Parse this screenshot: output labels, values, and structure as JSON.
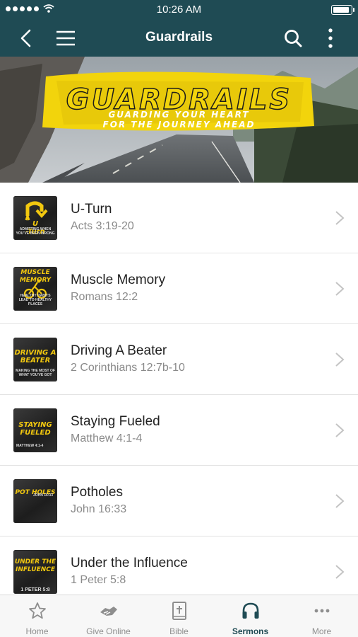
{
  "status_bar": {
    "time": "10:26 AM"
  },
  "nav": {
    "title": "Guardrails"
  },
  "banner": {
    "title": "GUARDRAILS",
    "subtitle_line1": "GUARDING YOUR HEART",
    "subtitle_line2": "FOR THE JOURNEY AHEAD"
  },
  "sermons": [
    {
      "title": "U-Turn",
      "reference": "Acts 3:19-20",
      "thumb_text": "U\n-Turn",
      "thumb_small": "ADMITTING WHEN YOU'VE BEEN WRONG"
    },
    {
      "title": "Muscle Memory",
      "reference": "Romans 12:2",
      "thumb_text": "MUSCLE MEMORY",
      "thumb_small": "HEALTHY HABITS LEAD TO HEALTHY PLACES"
    },
    {
      "title": "Driving A Beater",
      "reference": "2 Corinthians 12:7b-10",
      "thumb_text": "DRIVING A BEATER",
      "thumb_small": "MAKING THE MOST OF WHAT YOU'VE GOT"
    },
    {
      "title": "Staying Fueled",
      "reference": "Matthew 4:1-4",
      "thumb_text": "STAYING FUELED",
      "thumb_small": "MATTHEW 4:1-4"
    },
    {
      "title": "Potholes",
      "reference": "John 16:33",
      "thumb_text": "POT HOLES",
      "thumb_small": "JOHN 16:33"
    },
    {
      "title": "Under the Influence",
      "reference": "1 Peter 5:8",
      "thumb_text": "UNDER THE INFLUENCE",
      "thumb_small": "1 PETER 5:8"
    }
  ],
  "tabs": [
    {
      "label": "Home",
      "icon": "star-icon"
    },
    {
      "label": "Give Online",
      "icon": "handshake-icon"
    },
    {
      "label": "Bible",
      "icon": "bible-icon"
    },
    {
      "label": "Sermons",
      "icon": "headphones-icon",
      "active": true
    },
    {
      "label": "More",
      "icon": "more-dots-icon"
    }
  ],
  "colors": {
    "primary": "#1f4b54",
    "accent_yellow": "#f2d40c",
    "inactive": "#8e8e8e"
  }
}
